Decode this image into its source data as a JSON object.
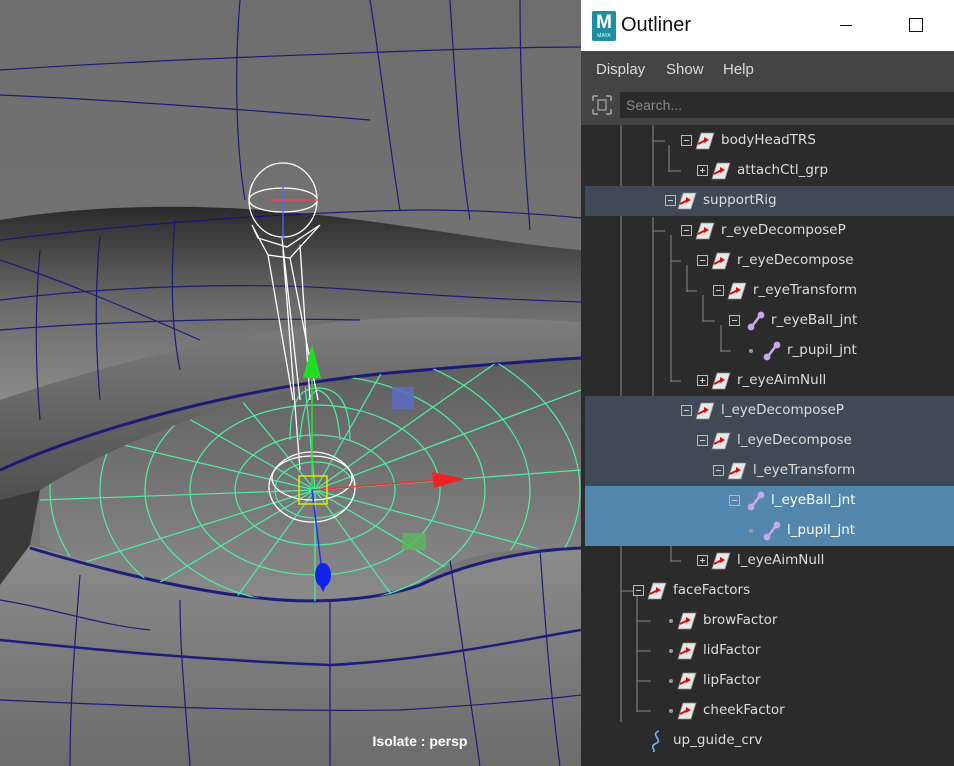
{
  "viewport": {
    "isolate_label": "Isolate : persp"
  },
  "outliner": {
    "title": "Outliner",
    "logo_text": "M",
    "logo_subtext": "MAYA",
    "menu": [
      "Display",
      "Show",
      "Help"
    ],
    "search": {
      "placeholder": "Search..."
    },
    "colors": {
      "selected": "#5386ad",
      "highlight": "#3f4a56",
      "list_bg": "#2b2b2b"
    },
    "tree": [
      {
        "label": "bodyHeadTRS",
        "depth": 3,
        "type": "transform",
        "expander": "minus",
        "state": ""
      },
      {
        "label": "attachCtl_grp",
        "depth": 4,
        "type": "transform",
        "expander": "plus",
        "state": ""
      },
      {
        "label": "supportRig",
        "depth": 2,
        "type": "transform",
        "expander": "minus",
        "state": "highlighted"
      },
      {
        "label": "r_eyeDecomposeP",
        "depth": 3,
        "type": "transform",
        "expander": "minus",
        "state": ""
      },
      {
        "label": "r_eyeDecompose",
        "depth": 4,
        "type": "transform",
        "expander": "minus",
        "state": ""
      },
      {
        "label": "r_eyeTransform",
        "depth": 5,
        "type": "transform",
        "expander": "minus",
        "state": ""
      },
      {
        "label": "r_eyeBall_jnt",
        "depth": 6,
        "type": "joint",
        "expander": "minus",
        "state": ""
      },
      {
        "label": "r_pupil_jnt",
        "depth": 7,
        "type": "joint",
        "expander": "leaf",
        "state": ""
      },
      {
        "label": "r_eyeAimNull",
        "depth": 4,
        "type": "transform",
        "expander": "plus",
        "state": ""
      },
      {
        "label": "l_eyeDecomposeP",
        "depth": 3,
        "type": "transform",
        "expander": "minus",
        "state": "highlighted"
      },
      {
        "label": "l_eyeDecompose",
        "depth": 4,
        "type": "transform",
        "expander": "minus",
        "state": "highlighted"
      },
      {
        "label": "l_eyeTransform",
        "depth": 5,
        "type": "transform",
        "expander": "minus",
        "state": "highlighted"
      },
      {
        "label": "l_eyeBall_jnt",
        "depth": 6,
        "type": "joint",
        "expander": "minus",
        "state": "selected"
      },
      {
        "label": "l_pupil_jnt",
        "depth": 7,
        "type": "joint",
        "expander": "leaf",
        "state": "selected"
      },
      {
        "label": "l_eyeAimNull",
        "depth": 4,
        "type": "transform",
        "expander": "plus",
        "state": ""
      },
      {
        "label": "faceFactors",
        "depth": 1,
        "type": "transform",
        "expander": "minus",
        "state": ""
      },
      {
        "label": "browFactor",
        "depth": 2,
        "type": "transform",
        "expander": "leaf",
        "state": ""
      },
      {
        "label": "lidFactor",
        "depth": 2,
        "type": "transform",
        "expander": "leaf",
        "state": ""
      },
      {
        "label": "lipFactor",
        "depth": 2,
        "type": "transform",
        "expander": "leaf",
        "state": ""
      },
      {
        "label": "cheekFactor",
        "depth": 2,
        "type": "transform",
        "expander": "leaf",
        "state": ""
      },
      {
        "label": "up_guide_crv",
        "depth": 1,
        "type": "curve",
        "expander": "none",
        "state": ""
      }
    ]
  }
}
